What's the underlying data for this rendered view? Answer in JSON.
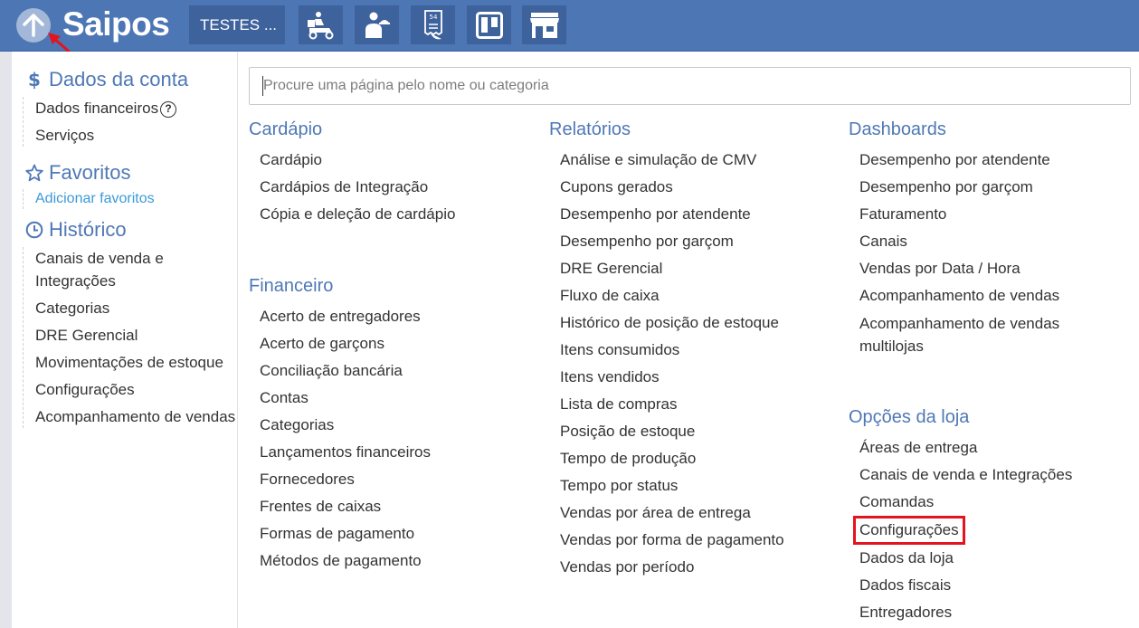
{
  "header": {
    "logo": "Saipos",
    "store_label": "TESTES ...",
    "toolbar_icons": [
      "delivery-icon",
      "waiter-icon",
      "order-ticket-icon",
      "kanban-board-icon",
      "store-icon"
    ]
  },
  "sidebar": {
    "account": {
      "title": "Dados da conta",
      "items": [
        "Dados financeiros",
        "Serviços"
      ],
      "help": "?"
    },
    "favorites": {
      "title": "Favoritos",
      "add_link": "Adicionar favoritos"
    },
    "history": {
      "title": "Histórico",
      "items": [
        "Canais de venda e Integrações",
        "Categorias",
        "DRE Gerencial",
        "Movimentações de estoque",
        "Configurações",
        "Acompanhamento de vendas"
      ]
    }
  },
  "search": {
    "placeholder": "Procure uma página pelo nome ou categoria"
  },
  "sections": {
    "cardapio": {
      "title": "Cardápio",
      "items": [
        "Cardápio",
        "Cardápios de Integração",
        "Cópia e deleção de cardápio"
      ]
    },
    "financeiro": {
      "title": "Financeiro",
      "items": [
        "Acerto de entregadores",
        "Acerto de garçons",
        "Conciliação bancária",
        "Contas",
        "Categorias",
        "Lançamentos financeiros",
        "Fornecedores",
        "Frentes de caixas",
        "Formas de pagamento",
        "Métodos de pagamento"
      ]
    },
    "relatorios": {
      "title": "Relatórios",
      "items": [
        "Análise e simulação de CMV",
        "Cupons gerados",
        "Desempenho por atendente",
        "Desempenho por garçom",
        "DRE Gerencial",
        "Fluxo de caixa",
        "Histórico de posição de estoque",
        "Itens consumidos",
        "Itens vendidos",
        "Lista de compras",
        "Posição de estoque",
        "Tempo de produção",
        "Tempo por status",
        "Vendas por área de entrega",
        "Vendas por forma de pagamento",
        "Vendas por período"
      ]
    },
    "dashboards": {
      "title": "Dashboards",
      "items": [
        "Desempenho por atendente",
        "Desempenho por garçom",
        "Faturamento",
        "Canais",
        "Vendas por Data / Hora",
        "Acompanhamento de vendas",
        "Acompanhamento de vendas multilojas"
      ]
    },
    "opcoes_loja": {
      "title": "Opções da loja",
      "items": [
        "Áreas de entrega",
        "Canais de venda e Integrações",
        "Comandas",
        "Configurações",
        "Dados da loja",
        "Dados fiscais",
        "Entregadores"
      ]
    }
  },
  "colors": {
    "header_bg": "#4d76b5",
    "accent": "#4f78b6",
    "link": "#3a9ad9",
    "highlight": "#e3141d"
  }
}
